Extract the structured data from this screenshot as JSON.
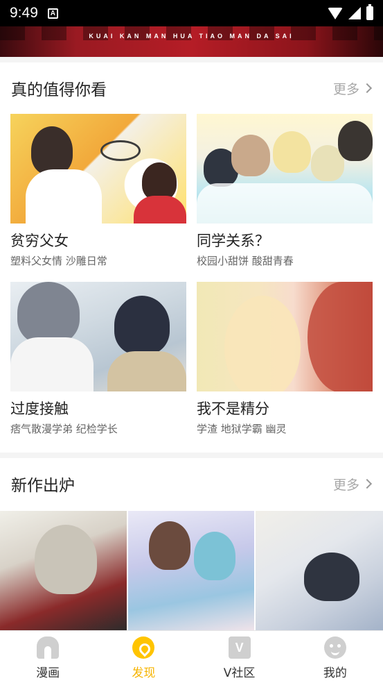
{
  "status_bar": {
    "time": "9:49",
    "notification_icon": "A"
  },
  "banner": {
    "subtitle": "KUAI KAN MAN HUA TIAO MAN DA SAI"
  },
  "section_recommend": {
    "title": "真的值得你看",
    "more_label": "更多",
    "items": [
      {
        "name": "贫穷父女",
        "tags": "塑料父女情 沙雕日常"
      },
      {
        "name": "同学关系？",
        "tags": "校园小甜饼 酸甜青春"
      },
      {
        "name": "过度接触",
        "tags": "痞气散漫学弟 纪检学长"
      },
      {
        "name": "我不是精分",
        "tags": "学渣 地狱学霸 幽灵"
      }
    ]
  },
  "section_new": {
    "title": "新作出炉",
    "more_label": "更多"
  },
  "tabbar": {
    "items": [
      {
        "label": "漫画",
        "icon": "comic-icon",
        "active": false
      },
      {
        "label": "发现",
        "icon": "discover-icon",
        "active": true
      },
      {
        "label": "V社区",
        "icon": "v-community-icon",
        "active": false
      },
      {
        "label": "我的",
        "icon": "profile-icon",
        "active": false
      }
    ]
  },
  "colors": {
    "accent": "#f6b400",
    "inactive_icon": "#cfcfcf",
    "secondary_text": "#a8a8a8"
  }
}
